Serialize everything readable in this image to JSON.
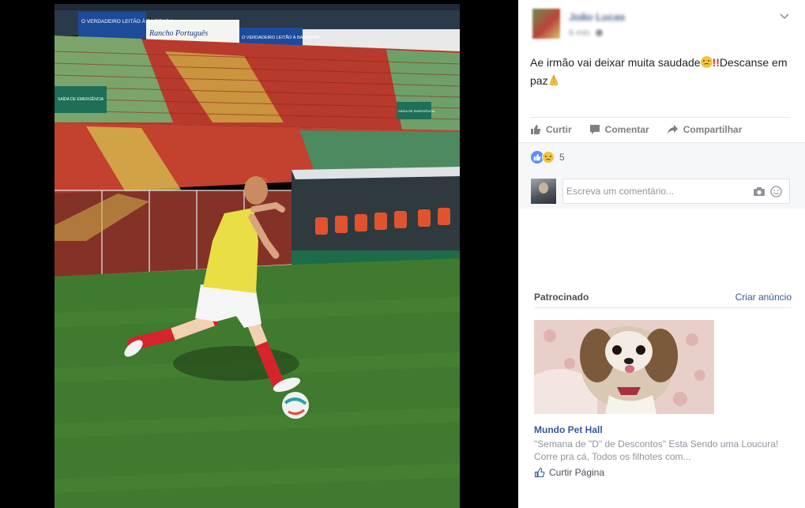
{
  "post": {
    "author": "João Lucas",
    "time": "6 min",
    "text_part1": "Ae irmão vai deixar muita saudade",
    "text_bang": "!!",
    "text_part2": "Descanse em paz"
  },
  "photo_banners": {
    "banner_left": "O VERDADEIRO LEITÃO À BAIRRADA",
    "banner_middle": "Rancho Português",
    "banner_right": "O VERDADEIRO LEITÃO À BAIRRADA",
    "sign_left": "SAÍDA DE EMERGÊNCIA",
    "sign_right": "SAÍDA DE EMERGÊNCIA"
  },
  "actions": {
    "like": "Curtir",
    "comment": "Comentar",
    "share": "Compartilhar"
  },
  "reactions": {
    "count": "5"
  },
  "comment": {
    "placeholder": "Escreva um comentário..."
  },
  "sponsored": {
    "title": "Patrocinado",
    "create_ad": "Criar anúncio",
    "ad_name": "Mundo Pet Hall",
    "ad_description": "\"Semana de \"D\" de Descontos\" Esta Sendo uma Loucura! Corre pra cá, Todos os filhotes com...",
    "ad_like": "Curtir Página"
  },
  "icons": {
    "like": "thumbs-up-icon",
    "comment": "speech-bubble-icon",
    "share": "share-arrow-icon",
    "camera": "camera-icon",
    "emoji": "smiley-icon",
    "chevron": "chevron-down-icon"
  },
  "colors": {
    "link": "#365899",
    "reaction_like": "#5890ff",
    "pitch": "#3f7a2f",
    "stands": "#c0392b"
  }
}
